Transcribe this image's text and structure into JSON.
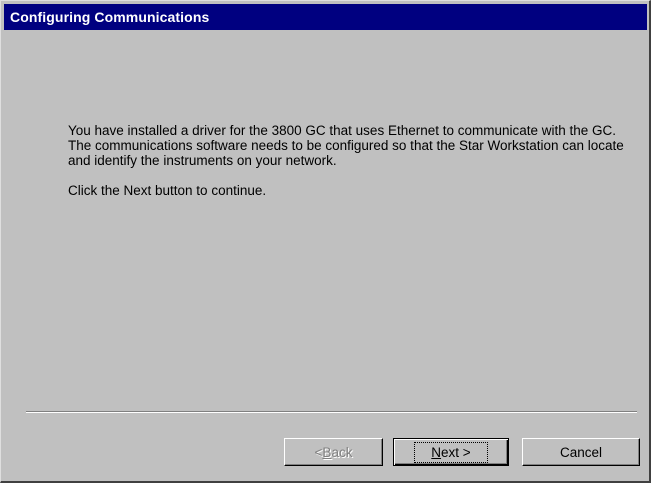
{
  "window": {
    "title": "Configuring Communications"
  },
  "content": {
    "paragraph1": "You have installed a driver for the 3800 GC that uses Ethernet to communicate with the GC.  The communications software needs to be configured so that the Star Workstation can locate and identify the instruments on your network.",
    "paragraph2": "Click the Next button to continue."
  },
  "buttons": {
    "back": {
      "prefix": "< ",
      "mnemonic": "B",
      "rest": "ack",
      "enabled": false
    },
    "next": {
      "mnemonic": "N",
      "rest": "ext >",
      "enabled": true,
      "default": true
    },
    "cancel": {
      "label": "Cancel",
      "enabled": true
    }
  },
  "colors": {
    "titlebar": "#000080",
    "dialog_face": "#c0c0c0",
    "disabled_text": "#808080"
  }
}
